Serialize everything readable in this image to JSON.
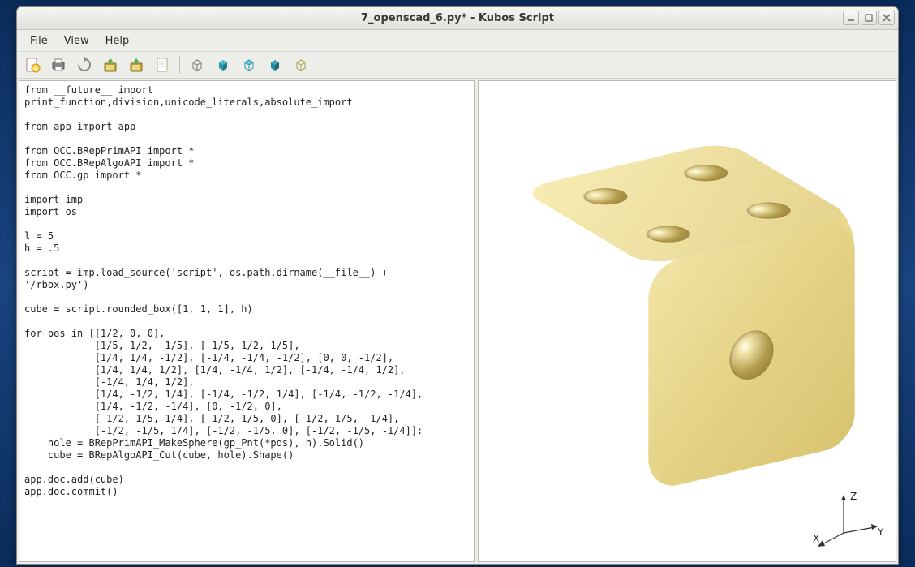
{
  "window": {
    "title": "7_openscad_6.py* - Kubos Script"
  },
  "menu": {
    "file": "File",
    "view": "View",
    "help": "Help"
  },
  "toolbar_icons": {
    "new": "new-file-icon",
    "print": "print-icon",
    "reload": "reload-icon",
    "save": "save-icon",
    "saveas": "save-as-icon",
    "page": "page-icon",
    "cube_wire": "cube-wireframe-icon",
    "cube_solid": "cube-solid-icon",
    "cube_hidden": "cube-hidden-icon",
    "cube_shaded": "cube-shaded-icon",
    "cube_bbox": "cube-bbox-icon"
  },
  "axis": {
    "x": "X",
    "y": "Y",
    "z": "Z"
  },
  "code": "from __future__ import\nprint_function,division,unicode_literals,absolute_import\n\nfrom app import app\n\nfrom OCC.BRepPrimAPI import *\nfrom OCC.BRepAlgoAPI import *\nfrom OCC.gp import *\n\nimport imp\nimport os\n\nl = 5\nh = .5\n\nscript = imp.load_source('script', os.path.dirname(__file__) +\n'/rbox.py')\n\ncube = script.rounded_box([1, 1, 1], h)\n\nfor pos in [[1/2, 0, 0],\n            [1/5, 1/2, -1/5], [-1/5, 1/2, 1/5],\n            [1/4, 1/4, -1/2], [-1/4, -1/4, -1/2], [0, 0, -1/2],\n            [1/4, 1/4, 1/2], [1/4, -1/4, 1/2], [-1/4, -1/4, 1/2],\n            [-1/4, 1/4, 1/2],\n            [1/4, -1/2, 1/4], [-1/4, -1/2, 1/4], [-1/4, -1/2, -1/4],\n            [1/4, -1/2, -1/4], [0, -1/2, 0],\n            [-1/2, 1/5, 1/4], [-1/2, 1/5, 0], [-1/2, 1/5, -1/4],\n            [-1/2, -1/5, 1/4], [-1/2, -1/5, 0], [-1/2, -1/5, -1/4]]:\n    hole = BRepPrimAPI_MakeSphere(gp_Pnt(*pos), h).Solid()\n    cube = BRepAlgoAPI_Cut(cube, hole).Shape()\n\napp.doc.add(cube)\napp.doc.commit()"
}
